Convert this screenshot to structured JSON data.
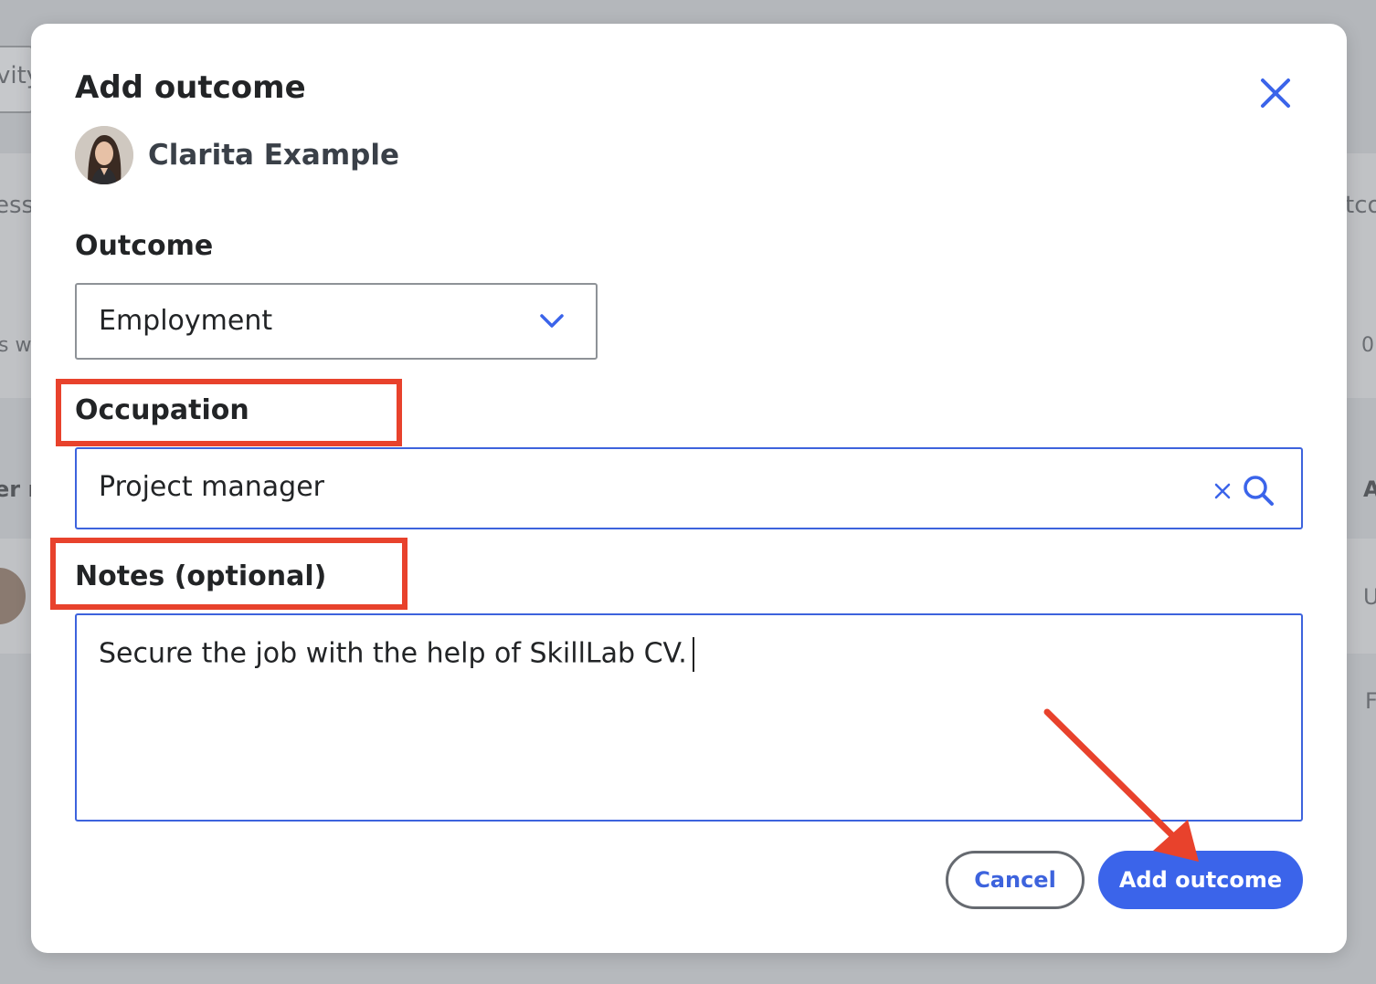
{
  "background": {
    "fragments": [
      "vity",
      "ess",
      "s w",
      "er r",
      "tco",
      "0",
      "A",
      "U",
      "F"
    ]
  },
  "modal": {
    "title": "Add outcome",
    "user": {
      "name": "Clarita Example"
    },
    "outcome": {
      "label": "Outcome",
      "selected": "Employment"
    },
    "occupation": {
      "label": "Occupation",
      "value": "Project manager"
    },
    "notes": {
      "label": "Notes (optional)",
      "value": "Secure the job with the help of SkillLab CV."
    },
    "actions": {
      "cancel_label": "Cancel",
      "submit_label": "Add outcome"
    }
  },
  "colors": {
    "accent": "#3b64ea",
    "annotation": "#e8422c",
    "title_text": "#222426",
    "name_text": "#3a4048"
  },
  "icons": {
    "close": "close-icon",
    "dropdown": "chevron-down-icon",
    "clear": "clear-x-icon",
    "search": "search-icon"
  }
}
